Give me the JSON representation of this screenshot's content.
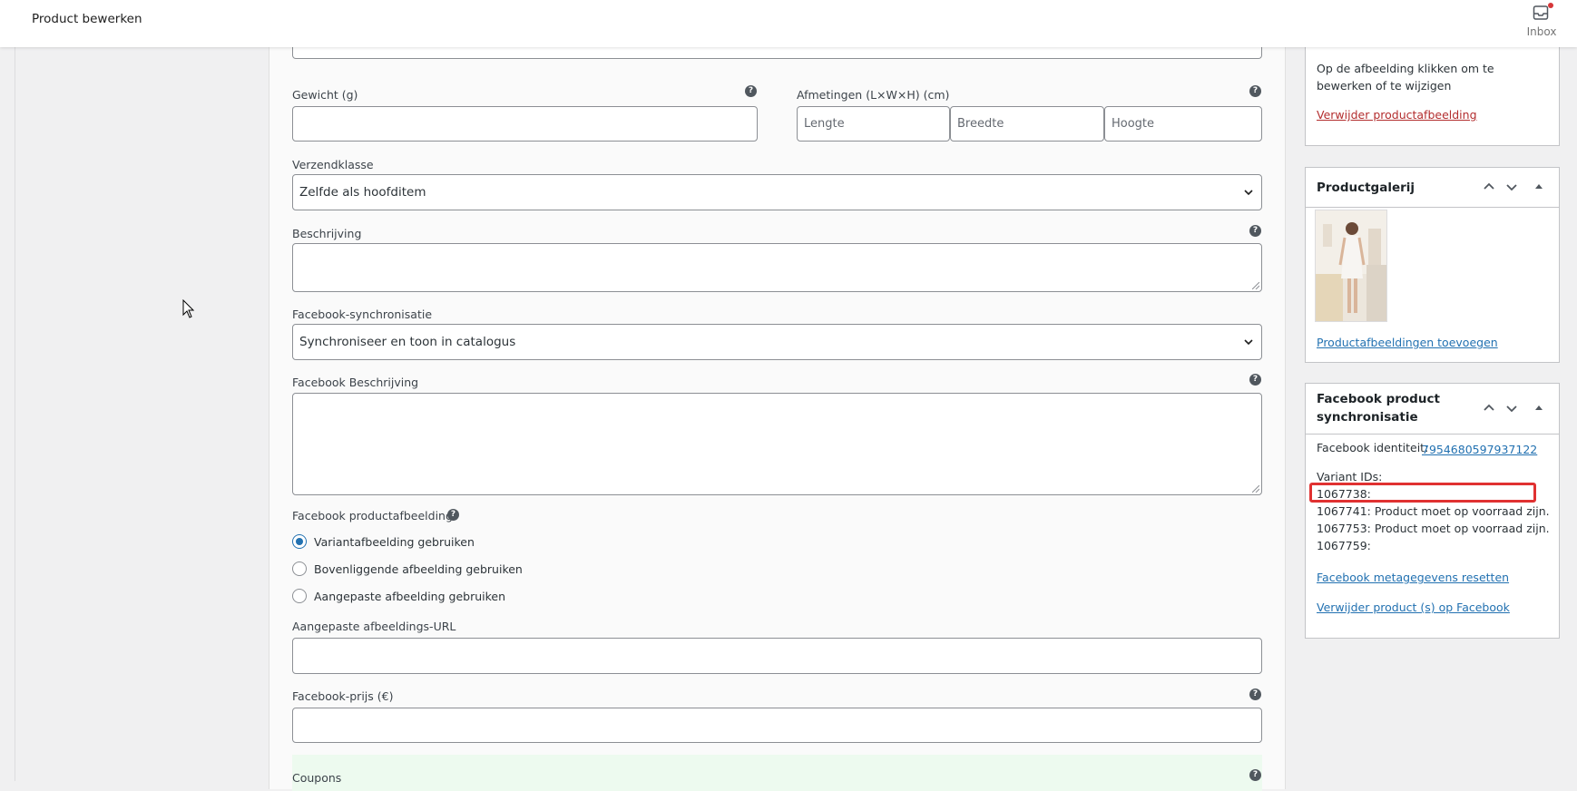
{
  "topbar": {
    "title": "Product bewerken",
    "inbox_label": "Inbox"
  },
  "form": {
    "weight_label": "Gewicht (g)",
    "weight_value": "",
    "dimensions_label": "Afmetingen (L×W×H) (cm)",
    "length_placeholder": "Lengte",
    "width_placeholder": "Breedte",
    "height_placeholder": "Hoogte",
    "shipping_class_label": "Verzendklasse",
    "shipping_class_value": "Zelfde als hoofditem",
    "description_label": "Beschrijving",
    "fb_sync_label": "Facebook-synchronisatie",
    "fb_sync_value": "Synchroniseer en toon in catalogus",
    "fb_description_label": "Facebook Beschrijving",
    "fb_image_label": "Facebook productafbeelding",
    "fb_image_options": [
      {
        "label": "Variantafbeelding gebruiken",
        "selected": true
      },
      {
        "label": "Bovenliggende afbeelding gebruiken",
        "selected": false
      },
      {
        "label": "Aangepaste afbeelding gebruiken",
        "selected": false
      }
    ],
    "custom_image_url_label": "Aangepaste afbeeldings-URL",
    "fb_price_label": "Facebook-prijs (€)",
    "coupons_label": "Coupons"
  },
  "sidebar": {
    "product_image": {
      "hint": "Op de afbeelding klikken om te bewerken of te wijzigen",
      "remove_link": "Verwijder productafbeelding"
    },
    "gallery": {
      "title": "Productgalerij",
      "add_link": "Productafbeeldingen toevoegen"
    },
    "fb_sync": {
      "title": "Facebook product synchronisatie",
      "identity_label": "Facebook identiteit:",
      "identity_value": "7954680597937122",
      "variant_ids_label": "Variant IDs:",
      "variants": [
        "1067738:",
        "1067741: Product moet op voorraad zijn.",
        "1067753: Product moet op voorraad zijn.",
        "1067759:"
      ],
      "reset_link": "Facebook metagegevens resetten",
      "delete_link": "Verwijder product (s) op Facebook"
    }
  },
  "colors": {
    "link": "#2271b1",
    "danger_link": "#b32d2e",
    "highlight": "#e03131",
    "radio_accent": "#2271b1"
  }
}
